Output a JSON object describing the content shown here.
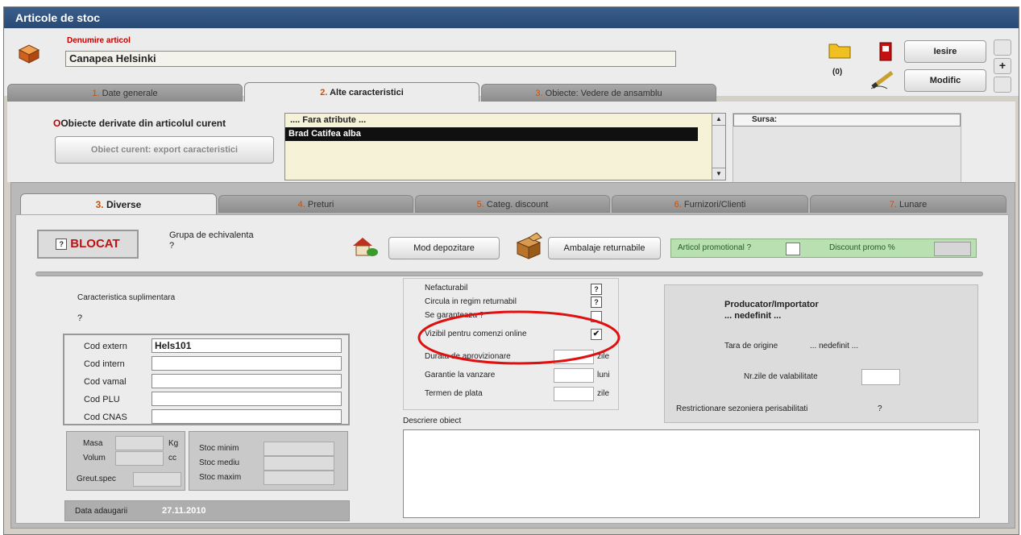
{
  "window": {
    "title": "Articole de stoc"
  },
  "header": {
    "denumire_label": "Denumire articol",
    "denumire_value": "Canapea Helsinki",
    "folder_count": "(0)",
    "iesire_label": "Iesire",
    "modific_label": "Modific"
  },
  "top_tabs": [
    {
      "num": "1.",
      "label": "Date generale"
    },
    {
      "num": "2.",
      "label": "Alte caracteristici"
    },
    {
      "num": "3.",
      "label": "Obiecte: Vedere de ansamblu"
    }
  ],
  "derivate": {
    "label": "Obiecte derivate din articolul curent",
    "export_btn": "Obiect curent: export caracteristici",
    "list": [
      ".... Fara atribute ...",
      "Brad Catifea alba"
    ],
    "selected_index": 1,
    "sursa_label": "Sursa:"
  },
  "bottom_tabs": [
    {
      "num": "3.",
      "label": "Diverse"
    },
    {
      "num": "4.",
      "label": "Preturi"
    },
    {
      "num": "5.",
      "label": "Categ. discount"
    },
    {
      "num": "6.",
      "label": "Furnizori/Clienti"
    },
    {
      "num": "7.",
      "label": "Lunare"
    }
  ],
  "diverse": {
    "blocat_label": "BLOCAT",
    "grupa_label": "Grupa de echivalenta",
    "grupa_value": "?",
    "mod_depozitare": "Mod depozitare",
    "ambalaje": "Ambalaje returnabile",
    "articol_promo": "Articol promotional ?",
    "discount_promo": "Discount promo %",
    "caracteristica_label": "Caracteristica suplimentara",
    "caracteristica_value": "?",
    "codes": [
      {
        "label": "Cod extern",
        "value": "Hels101"
      },
      {
        "label": "Cod intern",
        "value": ""
      },
      {
        "label": "Cod vamal",
        "value": ""
      },
      {
        "label": "Cod PLU",
        "value": ""
      },
      {
        "label": "Cod CNAS",
        "value": ""
      }
    ],
    "masa_label": "Masa",
    "masa_unit": "Kg",
    "volum_label": "Volum",
    "volum_unit": "cc",
    "greut_label": "Greut.spec",
    "stoc_minim": "Stoc minim",
    "stoc_mediu": "Stoc mediu",
    "stoc_maxim": "Stoc maxim",
    "data_label": "Data adaugarii",
    "data_value": "27.11.2010",
    "flags": [
      {
        "label": "Nefacturabil",
        "mark": "?"
      },
      {
        "label": "Circula in regim returnabil",
        "mark": "?"
      },
      {
        "label": "Se garanteaza ?",
        "mark": ""
      },
      {
        "label": "Vizibil pentru comenzi online",
        "mark": "✔"
      }
    ],
    "durata_label": "Durata de aprovizionare",
    "durata_unit": "zile",
    "garantie_label": "Garantie la vanzare",
    "garantie_unit": "luni",
    "termen_label": "Termen de plata",
    "termen_unit": "zile",
    "descriere_label": "Descriere obiect",
    "producator_title": "Producator/Importator",
    "producator_value": "... nedefinit ...",
    "tara_label": "Tara de origine",
    "tara_value": "... nedefinit ...",
    "nr_zile_label": "Nr.zile de valabilitate",
    "restrictionare_label": "Restrictionare sezoniera perisabilitati",
    "restrictionare_value": "?"
  },
  "colors": {
    "title_bar": "#2f5582",
    "highlight_circle": "#e01010",
    "promo_bg": "#b9e0b0"
  },
  "icons": [
    "box-icon",
    "folder-icon",
    "exit-door-icon",
    "pencil-icon",
    "house-icon",
    "package-icon"
  ]
}
